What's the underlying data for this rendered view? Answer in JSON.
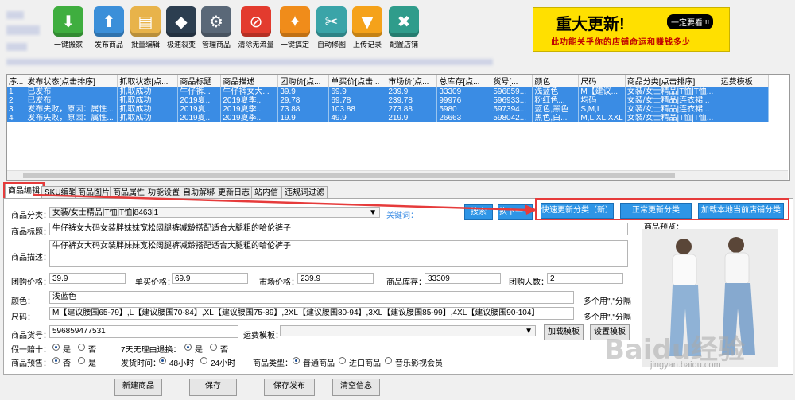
{
  "toolbar": [
    {
      "label": "一键搬家",
      "color": "#3fae3f",
      "glyph": "⬇",
      "icon": "download-icon"
    },
    {
      "label": "发布商品",
      "color": "#3b8fd9",
      "glyph": "⬆",
      "icon": "upload-icon"
    },
    {
      "label": "批量编辑",
      "color": "#e8b34a",
      "glyph": "▤",
      "icon": "batch-edit-icon"
    },
    {
      "label": "极速裂变",
      "color": "#2c3e50",
      "glyph": "◆",
      "icon": "layers-icon"
    },
    {
      "label": "管理商品",
      "color": "#5a6878",
      "glyph": "⚙",
      "icon": "gear-icon"
    },
    {
      "label": "清除无流量",
      "color": "#e33b2e",
      "glyph": "⊘",
      "icon": "clear-icon"
    },
    {
      "label": "一键搞定",
      "color": "#f08c1a",
      "glyph": "✦",
      "icon": "tag-icon"
    },
    {
      "label": "自动修图",
      "color": "#3aa4a8",
      "glyph": "✂",
      "icon": "scissors-icon"
    },
    {
      "label": "上传记录",
      "color": "#f5a21a",
      "glyph": "▼",
      "icon": "bookmark-icon"
    },
    {
      "label": "配置店铺",
      "color": "#2f9c8b",
      "glyph": "✖",
      "icon": "tools-icon"
    }
  ],
  "banner": {
    "title": "重大更新!",
    "badge": "一定要看!!!",
    "subtitle": "此功能关乎你的店铺命运和赚钱多少"
  },
  "grid": {
    "columns": [
      "序...",
      "发布状态[点击排序]",
      "抓取状态[点...",
      "商品标题",
      "商品描述",
      "团购价[点...",
      "单买价[点击...",
      "市场价[点...",
      "总库存[点...",
      "货号[...",
      "颜色",
      "尺码",
      "商品分类[点击排序]",
      "运费模板"
    ],
    "rows": [
      [
        "1",
        "已发布",
        "抓取成功",
        "牛仔裤...",
        "牛仔裤女大...",
        "39.9",
        "69.9",
        "239.9",
        "33309",
        "596859...",
        "浅蓝色",
        "M【建议...",
        "女装/女士精品|T恤|T恤...",
        ""
      ],
      [
        "2",
        "已发布",
        "抓取成功",
        "2019夏...",
        "2019夏季...",
        "29.78",
        "69.78",
        "239.78",
        "99976",
        "596933...",
        "粉红色...",
        "均码",
        "女装/女士精品|连衣裙...",
        ""
      ],
      [
        "3",
        "发布失败，原因：属性...",
        "抓取成功",
        "2019夏...",
        "2019夏季...",
        "73.88",
        "103.88",
        "273.88",
        "5980",
        "597394...",
        "蓝色,黑色",
        "S,M,L",
        "女装/女士精品|连衣裙...",
        ""
      ],
      [
        "4",
        "发布失败，原因：属性...",
        "抓取成功",
        "2019夏...",
        "2019夏季...",
        "19.9",
        "49.9",
        "219.9",
        "26663",
        "598042...",
        "黑色,白...",
        "M,L,XL,XXL",
        "女装/女士精品|T恤|T恤...",
        ""
      ]
    ]
  },
  "tabs": [
    "商品编辑",
    "SKU编辑",
    "商品图片",
    "商品属性",
    "功能设置",
    "自助解绑",
    "更新日志",
    "站内信",
    "违规词过滤"
  ],
  "form": {
    "category_label": "商品分类：",
    "category_value": "女装/女士精品|T恤|T恤|8463|1",
    "keyword_label": "关键词：",
    "btn_search": "搜索",
    "btn_next": "换下一个",
    "btn_quick": "快速更新分类（新）",
    "btn_normal": "正常更新分类",
    "btn_load_local": "加载本地当前店铺分类",
    "title_label": "商品标题：",
    "title_value": "牛仔裤女大码女装胖妹妹宽松阔腿裤减龄搭配适合大腿粗的哈伦裤子",
    "desc_label": "商品描述：",
    "desc_value": "牛仔裤女大码女装胖妹妹宽松阔腿裤减龄搭配适合大腿粗的哈伦裤子",
    "group_price_label": "团购价格：",
    "group_price": "39.9",
    "single_price_label": "单买价格：",
    "single_price": "69.9",
    "market_price_label": "市场价格：",
    "market_price": "239.9",
    "stock_label": "商品库存：",
    "stock": "33309",
    "group_people_label": "团购人数：",
    "group_people": "2",
    "color_label": "颜色：",
    "color_value": "浅蓝色",
    "multi_hint": "多个用\",\"分隔",
    "size_label": "尺码：",
    "size_value": "M【建议腰围65-79】,L【建议腰围70-84】,XL【建议腰围75-89】,2XL【建议腰围80-94】,3XL【建议腰围85-99】,4XL【建议腰围90-104】",
    "sku_label": "商品货号：",
    "sku_value": "596859477531",
    "freight_label": "运费模板：",
    "btn_load_tpl": "加载模板",
    "btn_set_tpl": "设置模板",
    "fake_label": "假一赔十：",
    "yes": "是",
    "no": "否",
    "return_label": "7天无理由退换：",
    "presale_label": "商品预售：",
    "ship_label": "发货时间：",
    "ship48": "48小时",
    "ship24": "24小时",
    "type_label": "商品类型：",
    "type_normal": "普通商品",
    "type_import": "进口商品",
    "type_music": "音乐影视会员",
    "preview_label": "商品预览："
  },
  "bottom": {
    "new": "新建商品",
    "save": "保存",
    "save_publish": "保存发布",
    "clear": "清空信息"
  },
  "watermark": "Baidu经验",
  "watermark_url": "jingyan.baidu.com"
}
